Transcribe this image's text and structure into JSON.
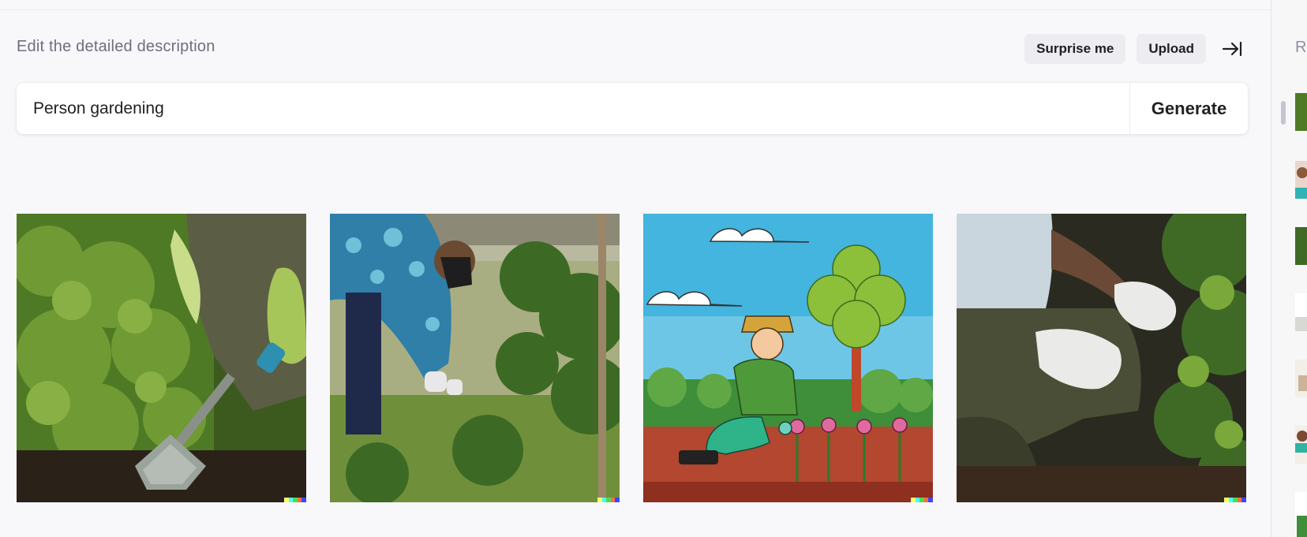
{
  "header": {
    "title": "Edit the detailed description",
    "surprise_label": "Surprise me",
    "upload_label": "Upload"
  },
  "prompt": {
    "value": "Person gardening",
    "generate_label": "Generate"
  },
  "results": [
    {
      "name": "result-image-1",
      "subject": "gloved hand with trowel among herbs"
    },
    {
      "name": "result-image-2",
      "subject": "man in floral shirt bending in garden"
    },
    {
      "name": "result-image-3",
      "subject": "cartoon gardener planting flowers"
    },
    {
      "name": "result-image-4",
      "subject": "gloved hands pulling weeds"
    }
  ],
  "sidebar": {
    "title": "R"
  },
  "colors": {
    "background": "#f8f8fa",
    "pill": "#ececf1",
    "text": "#202123",
    "muted": "#6e6e80"
  }
}
